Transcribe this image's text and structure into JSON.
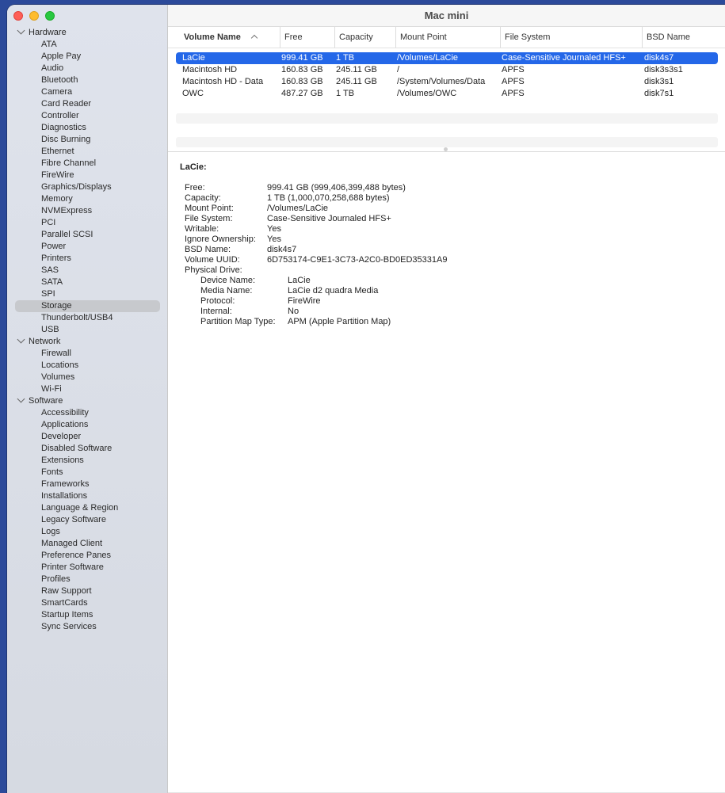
{
  "window": {
    "title": "Mac mini"
  },
  "sidebar": {
    "items": [
      {
        "label": "Hardware",
        "kind": "cat"
      },
      {
        "label": "ATA",
        "kind": "item"
      },
      {
        "label": "Apple Pay",
        "kind": "item"
      },
      {
        "label": "Audio",
        "kind": "item"
      },
      {
        "label": "Bluetooth",
        "kind": "item"
      },
      {
        "label": "Camera",
        "kind": "item"
      },
      {
        "label": "Card Reader",
        "kind": "item"
      },
      {
        "label": "Controller",
        "kind": "item"
      },
      {
        "label": "Diagnostics",
        "kind": "item"
      },
      {
        "label": "Disc Burning",
        "kind": "item"
      },
      {
        "label": "Ethernet",
        "kind": "item"
      },
      {
        "label": "Fibre Channel",
        "kind": "item"
      },
      {
        "label": "FireWire",
        "kind": "item"
      },
      {
        "label": "Graphics/Displays",
        "kind": "item"
      },
      {
        "label": "Memory",
        "kind": "item"
      },
      {
        "label": "NVMExpress",
        "kind": "item"
      },
      {
        "label": "PCI",
        "kind": "item"
      },
      {
        "label": "Parallel SCSI",
        "kind": "item"
      },
      {
        "label": "Power",
        "kind": "item"
      },
      {
        "label": "Printers",
        "kind": "item"
      },
      {
        "label": "SAS",
        "kind": "item"
      },
      {
        "label": "SATA",
        "kind": "item"
      },
      {
        "label": "SPI",
        "kind": "item"
      },
      {
        "label": "Storage",
        "kind": "item",
        "selected": true
      },
      {
        "label": "Thunderbolt/USB4",
        "kind": "item"
      },
      {
        "label": "USB",
        "kind": "item"
      },
      {
        "label": "Network",
        "kind": "cat"
      },
      {
        "label": "Firewall",
        "kind": "item"
      },
      {
        "label": "Locations",
        "kind": "item"
      },
      {
        "label": "Volumes",
        "kind": "item"
      },
      {
        "label": "Wi-Fi",
        "kind": "item"
      },
      {
        "label": "Software",
        "kind": "cat"
      },
      {
        "label": "Accessibility",
        "kind": "item"
      },
      {
        "label": "Applications",
        "kind": "item"
      },
      {
        "label": "Developer",
        "kind": "item"
      },
      {
        "label": "Disabled Software",
        "kind": "item"
      },
      {
        "label": "Extensions",
        "kind": "item"
      },
      {
        "label": "Fonts",
        "kind": "item"
      },
      {
        "label": "Frameworks",
        "kind": "item"
      },
      {
        "label": "Installations",
        "kind": "item"
      },
      {
        "label": "Language & Region",
        "kind": "item"
      },
      {
        "label": "Legacy Software",
        "kind": "item"
      },
      {
        "label": "Logs",
        "kind": "item"
      },
      {
        "label": "Managed Client",
        "kind": "item"
      },
      {
        "label": "Preference Panes",
        "kind": "item"
      },
      {
        "label": "Printer Software",
        "kind": "item"
      },
      {
        "label": "Profiles",
        "kind": "item"
      },
      {
        "label": "Raw Support",
        "kind": "item"
      },
      {
        "label": "SmartCards",
        "kind": "item"
      },
      {
        "label": "Startup Items",
        "kind": "item"
      },
      {
        "label": "Sync Services",
        "kind": "item"
      }
    ]
  },
  "table": {
    "columns": [
      "Volume Name",
      "Free",
      "Capacity",
      "Mount Point",
      "File System",
      "BSD Name"
    ],
    "sort_icon": "chevron-up-icon",
    "rows": [
      [
        "LaCie",
        "999.41 GB",
        "1 TB",
        "/Volumes/LaCie",
        "Case-Sensitive Journaled HFS+",
        "disk4s7"
      ],
      [
        "Macintosh HD",
        "160.83 GB",
        "245.11 GB",
        "/",
        "APFS",
        "disk3s3s1"
      ],
      [
        "Macintosh HD - Data",
        "160.83 GB",
        "245.11 GB",
        "/System/Volumes/Data",
        "APFS",
        "disk3s1"
      ],
      [
        "OWC",
        "487.27 GB",
        "1 TB",
        "/Volumes/OWC",
        "APFS",
        "disk7s1"
      ]
    ],
    "selected_row": 0,
    "selection_color": "#2467e8"
  },
  "detail": {
    "title": "LaCie:",
    "fields": [
      {
        "k": "Free:",
        "v": "999.41 GB (999,406,399,488 bytes)"
      },
      {
        "k": "Capacity:",
        "v": "1 TB (1,000,070,258,688 bytes)"
      },
      {
        "k": "Mount Point:",
        "v": "/Volumes/LaCie"
      },
      {
        "k": "File System:",
        "v": "Case-Sensitive Journaled HFS+"
      },
      {
        "k": "Writable:",
        "v": "Yes"
      },
      {
        "k": "Ignore Ownership:",
        "v": "Yes"
      },
      {
        "k": "BSD Name:",
        "v": "disk4s7"
      },
      {
        "k": "Volume UUID:",
        "v": "6D753174-C9E1-3C73-A2C0-BD0ED35331A9"
      },
      {
        "k": "Physical Drive:",
        "v": ""
      }
    ],
    "physical": [
      {
        "k": "Device Name:",
        "v": "LaCie"
      },
      {
        "k": "Media Name:",
        "v": "LaCie d2 quadra Media"
      },
      {
        "k": "Protocol:",
        "v": "FireWire"
      },
      {
        "k": "Internal:",
        "v": "No"
      },
      {
        "k": "Partition Map Type:",
        "v": "APM (Apple Partition Map)"
      }
    ]
  }
}
